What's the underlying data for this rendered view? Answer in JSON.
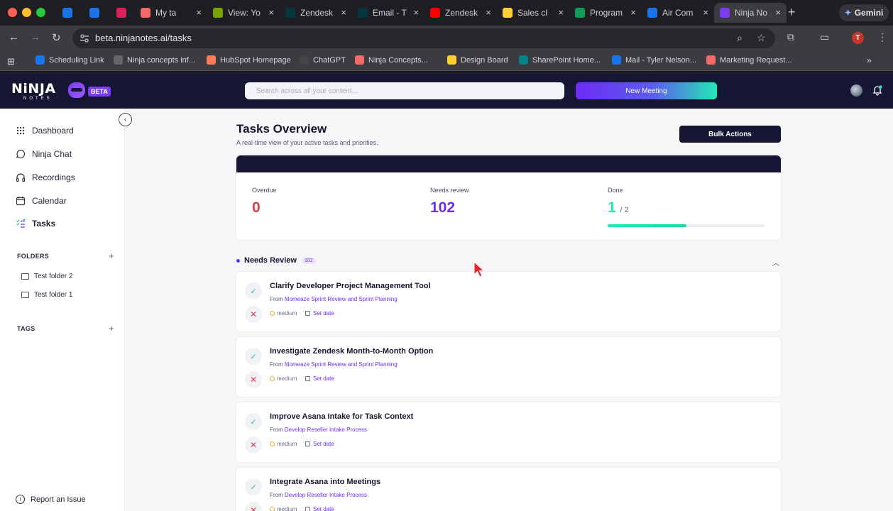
{
  "browser": {
    "tabs": [
      {
        "title": "",
        "favicon": "outlook-icon",
        "color": "#1a73e8",
        "pinned": true
      },
      {
        "title": "",
        "favicon": "calendar-icon",
        "color": "#1a73e8",
        "pinned": true
      },
      {
        "title": "",
        "favicon": "slack-icon",
        "color": "#e01e5a",
        "pinned": true
      },
      {
        "title": "My ta",
        "favicon": "asana-icon",
        "color": "#f06a6a"
      },
      {
        "title": "View: Yo",
        "favicon": "zendesk-icon",
        "color": "#78a300"
      },
      {
        "title": "Zendesk",
        "favicon": "zendesk-icon",
        "color": "#03363d"
      },
      {
        "title": "Email - T",
        "favicon": "zendesk-icon",
        "color": "#03363d"
      },
      {
        "title": "Zendesk",
        "favicon": "youtube-icon",
        "color": "#ff0000"
      },
      {
        "title": "Sales cl",
        "favicon": "miro-icon",
        "color": "#ffd02f"
      },
      {
        "title": "Program",
        "favicon": "sheets-icon",
        "color": "#0f9d58"
      },
      {
        "title": "Air Com",
        "favicon": "gear-icon",
        "color": "#1a73e8"
      },
      {
        "title": "Ninja No",
        "favicon": "ninja-icon",
        "color": "#7b3cf0",
        "active": true
      }
    ],
    "gemini_label": "Gemini",
    "url": "beta.ninjanotes.ai/tasks",
    "profile_initial": "T",
    "bookmarks": [
      {
        "label": "Scheduling Link",
        "icon": "calendar-icon",
        "color": "#1a73e8"
      },
      {
        "label": "Ninja concepts inf...",
        "icon": "globe-icon",
        "color": "#666"
      },
      {
        "label": "HubSpot Homepage",
        "icon": "hubspot-icon",
        "color": "#ff7a59"
      },
      {
        "label": "ChatGPT",
        "icon": "chatgpt-icon",
        "color": "#444"
      },
      {
        "label": "Ninja Concepts...",
        "icon": "asana-icon",
        "color": "#f06a6a"
      },
      {
        "label": "Design Board",
        "icon": "miro-icon",
        "color": "#ffd02f"
      },
      {
        "label": "SharePoint Home...",
        "icon": "sharepoint-icon",
        "color": "#038387"
      },
      {
        "label": "Mail - Tyler Nelson...",
        "icon": "outlook-icon",
        "color": "#1a73e8"
      },
      {
        "label": "Marketing Request...",
        "icon": "asana-icon",
        "color": "#f06a6a"
      }
    ]
  },
  "app": {
    "logo_text": "NiNJA",
    "logo_sub": "NOTES",
    "beta_label": "BETA",
    "search_placeholder": "Search across all your content...",
    "new_meeting_label": "New Meeting"
  },
  "sidebar": {
    "nav": [
      {
        "label": "Dashboard",
        "icon": "grid-icon"
      },
      {
        "label": "Ninja Chat",
        "icon": "chat-icon"
      },
      {
        "label": "Recordings",
        "icon": "headphones-icon"
      },
      {
        "label": "Calendar",
        "icon": "calendar-icon"
      },
      {
        "label": "Tasks",
        "icon": "tasks-icon",
        "active": true
      }
    ],
    "folders_label": "FOLDERS",
    "folders": [
      "Test folder 2",
      "Test folder 1"
    ],
    "tags_label": "TAGS",
    "report_label": "Report an Issue"
  },
  "page": {
    "title": "Tasks Overview",
    "subtitle": "A real-time view of your active tasks and priorities.",
    "bulk_actions_label": "Bulk Actions",
    "stats": {
      "overdue_label": "Overdue",
      "overdue_value": "0",
      "review_label": "Needs review",
      "review_value": "102",
      "done_label": "Done",
      "done_value": "1",
      "done_total": "/ 2",
      "done_fraction": 0.5
    },
    "group": {
      "title": "Needs Review",
      "count": "102"
    },
    "tasks": [
      {
        "title": "Clarify Developer Project Management Tool",
        "from_prefix": "From",
        "source": "Momeaze Sprint Review and Sprint Planning",
        "priority": "medium",
        "date_label": "Set date"
      },
      {
        "title": "Investigate Zendesk Month-to-Month Option",
        "from_prefix": "From",
        "source": "Momeaze Sprint Review and Sprint Planning",
        "priority": "medium",
        "date_label": "Set date"
      },
      {
        "title": "Improve Asana Intake for Task Context",
        "from_prefix": "From",
        "source": "Develop Reseller Intake Process",
        "priority": "medium",
        "date_label": "Set date"
      },
      {
        "title": "Integrate Asana into Meetings",
        "from_prefix": "From",
        "source": "Develop Reseller Intake Process",
        "priority": "medium",
        "date_label": "Set date"
      }
    ]
  },
  "colors": {
    "accent": "#6c2cf5",
    "overdue": "#e0394c",
    "review": "#6c2cf5",
    "done": "#24e8b2",
    "header_bg": "#151634"
  }
}
